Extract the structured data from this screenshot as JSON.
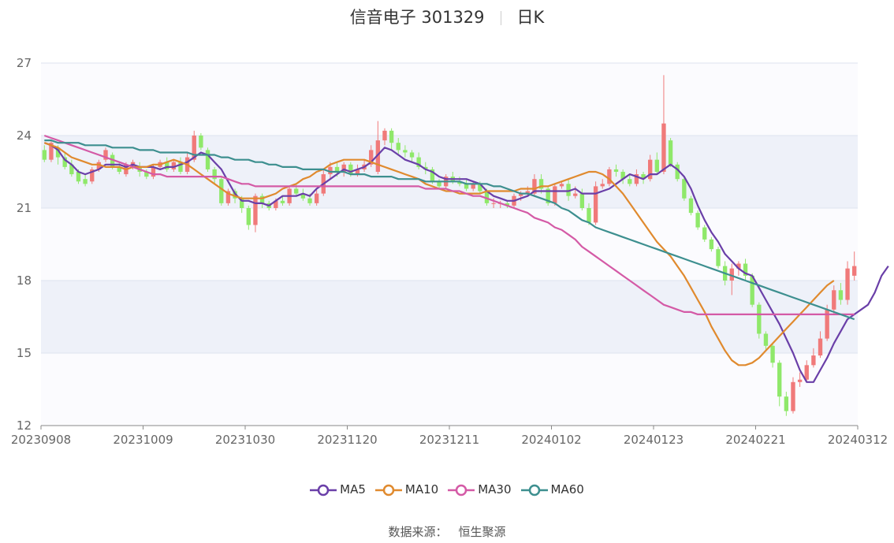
{
  "header": {
    "stock_name_code": "信音电子 301329",
    "period_label": "日K"
  },
  "legend": {
    "items": [
      {
        "label": "MA5",
        "color": "#6a3fa8"
      },
      {
        "label": "MA10",
        "color": "#e08a2e"
      },
      {
        "label": "MA30",
        "color": "#d45aa6"
      },
      {
        "label": "MA60",
        "color": "#3d8f8f"
      }
    ]
  },
  "source": {
    "label": "数据来源：",
    "value": "恒生聚源"
  },
  "colors": {
    "up": "#f07a7a",
    "down": "#8fe86a",
    "grid": "#dde3ef",
    "band": "#eef1f9",
    "axis": "#888888"
  },
  "chart_data": {
    "type": "candlestick",
    "title": "信音电子 301329",
    "subtitle": "日K",
    "ylim": [
      12,
      27
    ],
    "y_ticks": [
      12,
      15,
      18,
      21,
      24,
      27
    ],
    "x_tick_labels": [
      "20230908",
      "20231009",
      "20231030",
      "20231120",
      "20231211",
      "20240102",
      "20240123",
      "20240221",
      "20240312"
    ],
    "num_days": 120,
    "candles": [
      [
        23.4,
        23.0,
        23.6,
        22.9
      ],
      [
        23.0,
        23.7,
        23.8,
        22.9
      ],
      [
        23.5,
        23.1,
        23.6,
        22.8
      ],
      [
        23.1,
        22.7,
        23.3,
        22.6
      ],
      [
        22.8,
        22.4,
        23.0,
        22.3
      ],
      [
        22.5,
        22.1,
        22.6,
        22.0
      ],
      [
        22.2,
        22.0,
        22.4,
        21.9
      ],
      [
        22.1,
        22.6,
        22.7,
        22.0
      ],
      [
        22.6,
        22.9,
        23.0,
        22.5
      ],
      [
        23.0,
        23.4,
        23.5,
        22.9
      ],
      [
        23.2,
        22.7,
        23.3,
        22.6
      ],
      [
        22.7,
        22.5,
        22.9,
        22.4
      ],
      [
        22.4,
        22.8,
        22.9,
        22.3
      ],
      [
        22.8,
        22.9,
        23.0,
        22.6
      ],
      [
        22.7,
        22.5,
        22.9,
        22.3
      ],
      [
        22.5,
        22.3,
        22.6,
        22.2
      ],
      [
        22.3,
        22.7,
        22.8,
        22.2
      ],
      [
        22.7,
        22.9,
        23.0,
        22.6
      ],
      [
        22.9,
        22.6,
        23.1,
        22.5
      ],
      [
        22.6,
        22.9,
        23.0,
        22.5
      ],
      [
        22.9,
        22.5,
        23.1,
        22.4
      ],
      [
        22.5,
        23.1,
        23.3,
        22.4
      ],
      [
        23.0,
        24.0,
        24.2,
        22.9
      ],
      [
        24.0,
        23.5,
        24.1,
        23.4
      ],
      [
        23.4,
        22.6,
        23.5,
        22.5
      ],
      [
        22.6,
        22.2,
        22.7,
        22.0
      ],
      [
        22.2,
        21.2,
        22.3,
        21.1
      ],
      [
        21.2,
        21.7,
        21.8,
        21.1
      ],
      [
        21.7,
        21.4,
        21.8,
        21.2
      ],
      [
        21.4,
        21.0,
        21.5,
        20.8
      ],
      [
        21.0,
        20.3,
        21.1,
        20.1
      ],
      [
        20.3,
        21.5,
        21.6,
        20.0
      ],
      [
        21.5,
        21.2,
        21.6,
        21.0
      ],
      [
        21.2,
        21.0,
        21.3,
        20.9
      ],
      [
        21.0,
        21.3,
        21.4,
        20.9
      ],
      [
        21.3,
        21.2,
        21.5,
        21.1
      ],
      [
        21.2,
        21.8,
        21.9,
        21.1
      ],
      [
        21.8,
        21.6,
        22.0,
        21.5
      ],
      [
        21.6,
        21.4,
        21.8,
        21.3
      ],
      [
        21.4,
        21.2,
        21.6,
        21.1
      ],
      [
        21.2,
        21.6,
        21.8,
        21.1
      ],
      [
        21.6,
        22.4,
        22.6,
        21.5
      ],
      [
        22.4,
        22.7,
        22.9,
        22.2
      ],
      [
        22.7,
        22.5,
        22.9,
        22.3
      ],
      [
        22.5,
        22.8,
        22.9,
        22.3
      ],
      [
        22.8,
        22.4,
        22.9,
        22.3
      ],
      [
        22.4,
        22.6,
        22.8,
        22.3
      ],
      [
        22.6,
        22.8,
        23.0,
        22.5
      ],
      [
        22.8,
        23.4,
        23.6,
        22.7
      ],
      [
        22.5,
        23.8,
        24.6,
        22.4
      ],
      [
        23.8,
        24.2,
        24.3,
        23.6
      ],
      [
        24.2,
        23.7,
        24.3,
        23.4
      ],
      [
        23.7,
        23.4,
        23.9,
        23.2
      ],
      [
        23.4,
        23.3,
        23.6,
        23.1
      ],
      [
        23.3,
        23.1,
        23.4,
        22.9
      ],
      [
        23.1,
        22.7,
        23.3,
        22.6
      ],
      [
        22.7,
        22.6,
        22.9,
        22.4
      ],
      [
        22.6,
        22.1,
        22.7,
        22.0
      ],
      [
        22.1,
        21.9,
        22.2,
        21.8
      ],
      [
        21.9,
        22.3,
        22.4,
        21.8
      ],
      [
        22.3,
        22.1,
        22.5,
        22.0
      ],
      [
        22.1,
        22.0,
        22.3,
        21.9
      ],
      [
        22.0,
        21.8,
        22.2,
        21.7
      ],
      [
        21.8,
        22.0,
        22.1,
        21.7
      ],
      [
        22.0,
        21.7,
        22.1,
        21.6
      ],
      [
        21.7,
        21.2,
        21.8,
        21.1
      ],
      [
        21.2,
        21.2,
        21.4,
        21.0
      ],
      [
        21.2,
        21.2,
        21.3,
        21.0
      ],
      [
        21.2,
        21.1,
        21.3,
        21.0
      ],
      [
        21.1,
        21.5,
        21.6,
        21.0
      ],
      [
        21.5,
        21.6,
        21.7,
        21.3
      ],
      [
        21.6,
        21.7,
        21.9,
        21.5
      ],
      [
        21.6,
        22.2,
        22.4,
        21.5
      ],
      [
        22.2,
        21.8,
        22.4,
        21.6
      ],
      [
        21.8,
        21.2,
        21.9,
        21.1
      ],
      [
        21.2,
        21.9,
        22.0,
        21.1
      ],
      [
        21.9,
        22.0,
        22.1,
        21.8
      ],
      [
        22.0,
        21.5,
        22.2,
        21.3
      ],
      [
        21.5,
        21.6,
        21.9,
        21.4
      ],
      [
        21.6,
        21.0,
        21.8,
        20.9
      ],
      [
        21.0,
        20.4,
        21.2,
        20.3
      ],
      [
        20.4,
        21.9,
        22.1,
        20.3
      ],
      [
        21.9,
        22.0,
        22.2,
        21.8
      ],
      [
        22.0,
        22.6,
        22.7,
        21.9
      ],
      [
        22.6,
        22.5,
        22.8,
        22.3
      ],
      [
        22.5,
        22.2,
        22.6,
        22.0
      ],
      [
        22.2,
        22.0,
        22.4,
        21.9
      ],
      [
        22.0,
        22.4,
        22.6,
        21.9
      ],
      [
        22.4,
        22.2,
        22.5,
        22.0
      ],
      [
        22.2,
        23.0,
        23.2,
        22.1
      ],
      [
        23.0,
        22.5,
        23.3,
        22.4
      ],
      [
        22.5,
        24.5,
        26.5,
        22.4
      ],
      [
        23.8,
        22.8,
        23.9,
        22.7
      ],
      [
        22.8,
        22.2,
        22.9,
        22.1
      ],
      [
        22.2,
        21.4,
        22.3,
        21.3
      ],
      [
        21.4,
        20.8,
        21.5,
        20.7
      ],
      [
        20.8,
        20.2,
        20.9,
        20.1
      ],
      [
        20.2,
        19.7,
        20.3,
        19.6
      ],
      [
        19.7,
        19.3,
        19.8,
        19.2
      ],
      [
        19.3,
        18.6,
        19.4,
        18.5
      ],
      [
        18.6,
        18.0,
        18.8,
        17.8
      ],
      [
        18.0,
        18.5,
        18.7,
        17.4
      ],
      [
        18.5,
        18.7,
        18.8,
        18.2
      ],
      [
        18.7,
        18.2,
        18.9,
        18.0
      ],
      [
        18.2,
        17.0,
        18.3,
        16.9
      ],
      [
        17.0,
        15.8,
        17.1,
        15.6
      ],
      [
        15.8,
        15.3,
        15.9,
        15.1
      ],
      [
        15.3,
        14.6,
        15.4,
        14.4
      ],
      [
        14.6,
        13.2,
        14.7,
        12.8
      ],
      [
        13.2,
        12.6,
        13.4,
        12.4
      ],
      [
        12.6,
        13.8,
        14.0,
        12.5
      ],
      [
        13.8,
        13.9,
        14.2,
        13.6
      ],
      [
        13.9,
        14.5,
        14.7,
        13.8
      ],
      [
        14.5,
        14.9,
        15.2,
        14.4
      ],
      [
        14.9,
        15.6,
        15.9,
        14.8
      ],
      [
        15.6,
        16.8,
        17.0,
        15.5
      ],
      [
        16.8,
        17.6,
        17.8,
        16.6
      ],
      [
        17.6,
        17.2,
        17.9,
        17.0
      ],
      [
        17.2,
        18.5,
        18.8,
        17.0
      ],
      [
        18.2,
        18.6,
        19.2,
        18.0
      ]
    ],
    "series": [
      {
        "name": "MA5",
        "values": [
          23.7,
          23.6,
          23.4,
          23.0,
          22.8,
          22.5,
          22.4,
          22.5,
          22.6,
          22.8,
          22.8,
          22.8,
          22.7,
          22.8,
          22.7,
          22.7,
          22.7,
          22.6,
          22.7,
          22.7,
          22.8,
          22.9,
          23.1,
          23.3,
          23.2,
          22.9,
          22.6,
          22.1,
          21.6,
          21.3,
          21.3,
          21.2,
          21.2,
          21.1,
          21.3,
          21.5,
          21.5,
          21.5,
          21.6,
          21.5,
          21.8,
          22.0,
          22.2,
          22.4,
          22.6,
          22.5,
          22.6,
          22.7,
          22.9,
          23.2,
          23.5,
          23.4,
          23.2,
          23.0,
          22.9,
          22.8,
          22.6,
          22.5,
          22.3,
          22.2,
          22.2,
          22.2,
          22.2,
          22.1,
          22.0,
          21.7,
          21.5,
          21.4,
          21.3,
          21.3,
          21.4,
          21.5,
          21.7,
          21.7,
          21.7,
          21.7,
          21.7,
          21.7,
          21.8,
          21.6,
          21.6,
          21.6,
          21.7,
          21.8,
          22.0,
          22.2,
          22.4,
          22.3,
          22.2,
          22.4,
          22.4,
          22.6,
          22.8,
          22.6,
          22.3,
          21.8,
          21.1,
          20.5,
          20.0,
          19.6,
          19.1,
          18.8,
          18.5,
          18.3,
          18.2,
          17.7,
          17.2,
          16.7,
          16.2,
          15.6,
          15.0,
          14.3,
          13.8,
          13.8,
          14.3,
          14.8,
          15.4,
          15.9,
          16.4,
          16.6,
          16.8,
          17.0,
          17.5,
          18.2,
          18.6
        ]
      },
      {
        "name": "MA10",
        "values": [
          23.7,
          23.6,
          23.5,
          23.3,
          23.1,
          23.0,
          22.9,
          22.8,
          22.8,
          22.7,
          22.7,
          22.7,
          22.6,
          22.7,
          22.7,
          22.7,
          22.8,
          22.8,
          22.9,
          23.0,
          22.9,
          22.8,
          22.6,
          22.4,
          22.2,
          22.0,
          21.8,
          21.6,
          21.5,
          21.4,
          21.4,
          21.4,
          21.4,
          21.5,
          21.6,
          21.8,
          21.9,
          22.0,
          22.2,
          22.3,
          22.5,
          22.6,
          22.8,
          22.9,
          23.0,
          23.0,
          23.0,
          23.0,
          22.9,
          22.8,
          22.7,
          22.6,
          22.5,
          22.4,
          22.3,
          22.2,
          22.0,
          21.9,
          21.8,
          21.7,
          21.7,
          21.6,
          21.6,
          21.6,
          21.6,
          21.7,
          21.7,
          21.7,
          21.7,
          21.7,
          21.8,
          21.8,
          21.8,
          21.9,
          21.9,
          22.0,
          22.1,
          22.2,
          22.3,
          22.4,
          22.5,
          22.5,
          22.4,
          22.2,
          21.9,
          21.6,
          21.2,
          20.8,
          20.4,
          20.0,
          19.6,
          19.3,
          19.0,
          18.6,
          18.2,
          17.7,
          17.2,
          16.7,
          16.1,
          15.6,
          15.1,
          14.7,
          14.5,
          14.5,
          14.6,
          14.8,
          15.1,
          15.4,
          15.7,
          16.0,
          16.3,
          16.6,
          16.9,
          17.2,
          17.5,
          17.8,
          18.0
        ]
      },
      {
        "name": "MA30",
        "values": [
          24.0,
          23.9,
          23.8,
          23.7,
          23.6,
          23.5,
          23.4,
          23.3,
          23.2,
          23.1,
          23.0,
          22.9,
          22.8,
          22.7,
          22.6,
          22.5,
          22.4,
          22.4,
          22.3,
          22.3,
          22.3,
          22.3,
          22.3,
          22.3,
          22.3,
          22.3,
          22.3,
          22.2,
          22.1,
          22.0,
          22.0,
          21.9,
          21.9,
          21.9,
          21.9,
          21.9,
          21.9,
          21.9,
          21.9,
          21.9,
          21.9,
          21.9,
          21.9,
          21.9,
          21.9,
          21.9,
          21.9,
          21.9,
          21.9,
          21.9,
          21.9,
          21.9,
          21.9,
          21.9,
          21.9,
          21.9,
          21.8,
          21.8,
          21.8,
          21.8,
          21.7,
          21.7,
          21.6,
          21.5,
          21.5,
          21.4,
          21.3,
          21.2,
          21.1,
          21.0,
          20.9,
          20.8,
          20.6,
          20.5,
          20.4,
          20.2,
          20.1,
          19.9,
          19.7,
          19.4,
          19.2,
          19.0,
          18.8,
          18.6,
          18.4,
          18.2,
          18.0,
          17.8,
          17.6,
          17.4,
          17.2,
          17.0,
          16.9,
          16.8,
          16.7,
          16.7,
          16.6,
          16.6,
          16.6,
          16.6,
          16.6,
          16.6,
          16.6,
          16.6,
          16.6,
          16.6,
          16.6,
          16.6,
          16.6,
          16.6,
          16.6,
          16.6,
          16.6,
          16.6,
          16.6,
          16.6,
          16.6,
          16.6,
          16.6,
          16.6
        ]
      },
      {
        "name": "MA60",
        "values": [
          23.8,
          23.8,
          23.7,
          23.7,
          23.7,
          23.7,
          23.6,
          23.6,
          23.6,
          23.6,
          23.5,
          23.5,
          23.5,
          23.5,
          23.4,
          23.4,
          23.4,
          23.3,
          23.3,
          23.3,
          23.3,
          23.3,
          23.2,
          23.2,
          23.2,
          23.2,
          23.1,
          23.1,
          23.0,
          23.0,
          23.0,
          22.9,
          22.9,
          22.8,
          22.8,
          22.7,
          22.7,
          22.7,
          22.6,
          22.6,
          22.6,
          22.6,
          22.5,
          22.5,
          22.5,
          22.4,
          22.4,
          22.4,
          22.3,
          22.3,
          22.3,
          22.3,
          22.2,
          22.2,
          22.2,
          22.2,
          22.1,
          22.1,
          22.1,
          22.1,
          22.1,
          22.1,
          22.0,
          22.0,
          22.0,
          22.0,
          21.9,
          21.9,
          21.8,
          21.7,
          21.6,
          21.6,
          21.5,
          21.4,
          21.3,
          21.2,
          21.0,
          20.9,
          20.7,
          20.5,
          20.4,
          20.2,
          20.1,
          20.0,
          19.9,
          19.8,
          19.7,
          19.6,
          19.5,
          19.4,
          19.3,
          19.2,
          19.1,
          19.0,
          18.9,
          18.8,
          18.7,
          18.6,
          18.5,
          18.4,
          18.3,
          18.2,
          18.1,
          18.0,
          17.9,
          17.8,
          17.7,
          17.6,
          17.5,
          17.4,
          17.3,
          17.2,
          17.1,
          17.0,
          16.9,
          16.8,
          16.7,
          16.6,
          16.5,
          16.4
        ]
      }
    ]
  }
}
